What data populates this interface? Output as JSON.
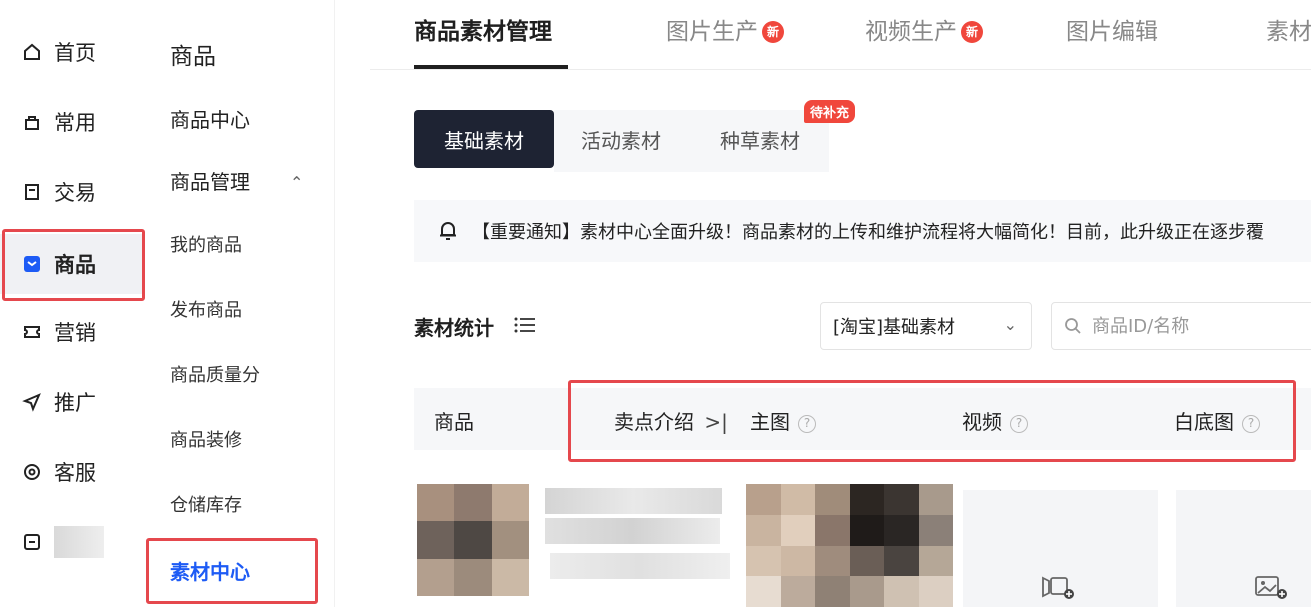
{
  "primary_nav": {
    "items": [
      {
        "label": "首页",
        "icon": "home-icon"
      },
      {
        "label": "常用",
        "icon": "bag-icon"
      },
      {
        "label": "交易",
        "icon": "receipt-icon"
      },
      {
        "label": "商品",
        "icon": "product-icon",
        "active": true
      },
      {
        "label": "营销",
        "icon": "ticket-icon"
      },
      {
        "label": "推广",
        "icon": "send-icon"
      },
      {
        "label": "客服",
        "icon": "chat-icon"
      }
    ]
  },
  "secondary_nav": {
    "title": "商品",
    "items": [
      "商品中心",
      "商品管理"
    ],
    "sub_items": [
      "我的商品",
      "发布商品",
      "商品质量分",
      "商品装修",
      "仓储库存",
      "素材中心"
    ],
    "active_sub": "素材中心"
  },
  "top_tabs": [
    {
      "label": "商品素材管理",
      "active": true
    },
    {
      "label": "图片生产",
      "badge": "新"
    },
    {
      "label": "视频生产",
      "badge": "新"
    },
    {
      "label": "图片编辑"
    },
    {
      "label": "素材"
    }
  ],
  "segments": {
    "items": [
      "基础素材",
      "活动素材",
      "种草素材"
    ],
    "active": "基础素材",
    "pending_badge": "待补充"
  },
  "notice": "【重要通知】素材中心全面升级！商品素材的上传和维护流程将大幅简化！目前，此升级正在逐步覆",
  "stats": {
    "title": "素材统计",
    "select_value": "[淘宝]基础素材",
    "search_placeholder": "商品ID/名称"
  },
  "table_header": {
    "product": "商品",
    "selling_point": "卖点介绍",
    "collapse": ">|",
    "main_image": "主图",
    "video": "视频",
    "white_bg": "白底图",
    "help": "?"
  },
  "colors": {
    "accent_blue": "#1d5bf5",
    "highlight_red": "#e5484d",
    "badge_red": "#f0473c",
    "dark_button": "#1e2333"
  }
}
